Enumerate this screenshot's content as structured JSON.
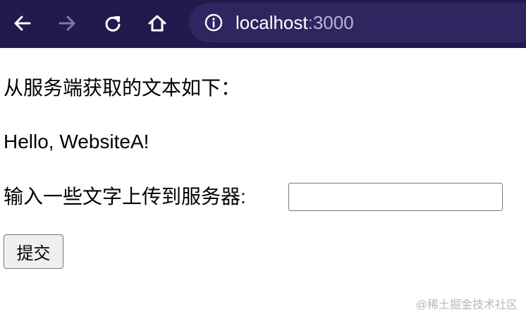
{
  "browser": {
    "url_host": "localhost",
    "url_port": ":3000",
    "icons": {
      "back": "back-arrow-icon",
      "forward": "forward-arrow-icon",
      "reload": "reload-icon",
      "home": "home-icon",
      "site_info": "info-icon"
    },
    "colors": {
      "toolbar": "#221a4d",
      "urlbar": "#2f2561",
      "forward_disabled": "#7d76a6"
    }
  },
  "page": {
    "server_text_heading": "从服务端获取的文本如下：",
    "server_text": "Hello, WebsiteA!",
    "input_label": "输入一些文字上传到服务器:",
    "input_value": "",
    "submit_label": "提交"
  },
  "watermark": "@稀土掘金技术社区"
}
